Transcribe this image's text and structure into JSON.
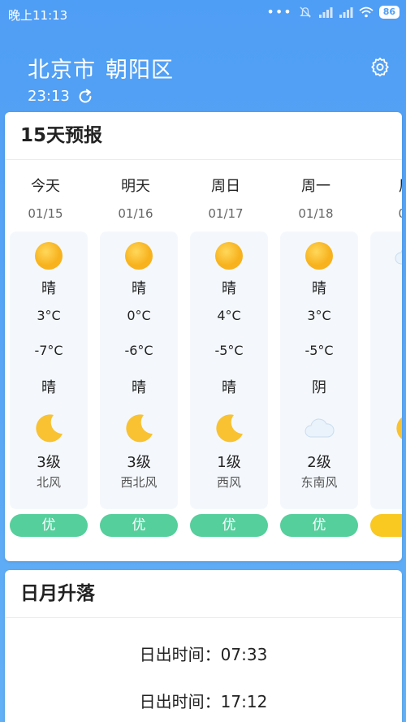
{
  "status_bar": {
    "time": "晚上11:13",
    "battery": "86",
    "icons": [
      "more-dots-icon",
      "mute-bell-icon",
      "signal-icon",
      "signal-icon",
      "wifi-icon",
      "battery-icon"
    ]
  },
  "header": {
    "city": "北京市",
    "district": "朝阳区",
    "update_time": "23:13",
    "icons": [
      "refresh-icon",
      "settings-icon"
    ]
  },
  "forecast": {
    "title": "15天预报",
    "days": [
      {
        "label": "今天",
        "date": "01/15",
        "day_condition": "晴",
        "high": "3°C",
        "low": "-7°C",
        "night_condition": "晴",
        "day_icon": "sun-icon",
        "night_icon": "moon-icon",
        "wind_level": "3级",
        "wind_dir": "北风",
        "aqi": "优"
      },
      {
        "label": "明天",
        "date": "01/16",
        "day_condition": "晴",
        "high": "0°C",
        "low": "-6°C",
        "night_condition": "晴",
        "day_icon": "sun-icon",
        "night_icon": "moon-icon",
        "wind_level": "3级",
        "wind_dir": "西北风",
        "aqi": "优"
      },
      {
        "label": "周日",
        "date": "01/17",
        "day_condition": "晴",
        "high": "4°C",
        "low": "-5°C",
        "night_condition": "晴",
        "day_icon": "sun-icon",
        "night_icon": "moon-icon",
        "wind_level": "1级",
        "wind_dir": "西风",
        "aqi": "优"
      },
      {
        "label": "周一",
        "date": "01/18",
        "day_condition": "晴",
        "high": "3°C",
        "low": "-5°C",
        "night_condition": "阴",
        "day_icon": "sun-icon",
        "night_icon": "cloud-icon",
        "wind_level": "2级",
        "wind_dir": "东南风",
        "aqi": "优"
      },
      {
        "label": "周",
        "date": "01",
        "day_condition": "",
        "high": "-",
        "low": "-",
        "night_condition": "",
        "day_icon": "cloud-icon",
        "night_icon": "moon-icon",
        "wind_level": "1",
        "wind_dir": "东",
        "aqi": ""
      }
    ],
    "colors": {
      "aqi_good": "#55cf9c",
      "aqi_moderate": "#f9c821",
      "sun": "#f9c22e"
    }
  },
  "sun_moon": {
    "title": "日月升落",
    "sunrise_label": "日出时间：07:33",
    "sunset_label": "日出时间：17:12"
  }
}
